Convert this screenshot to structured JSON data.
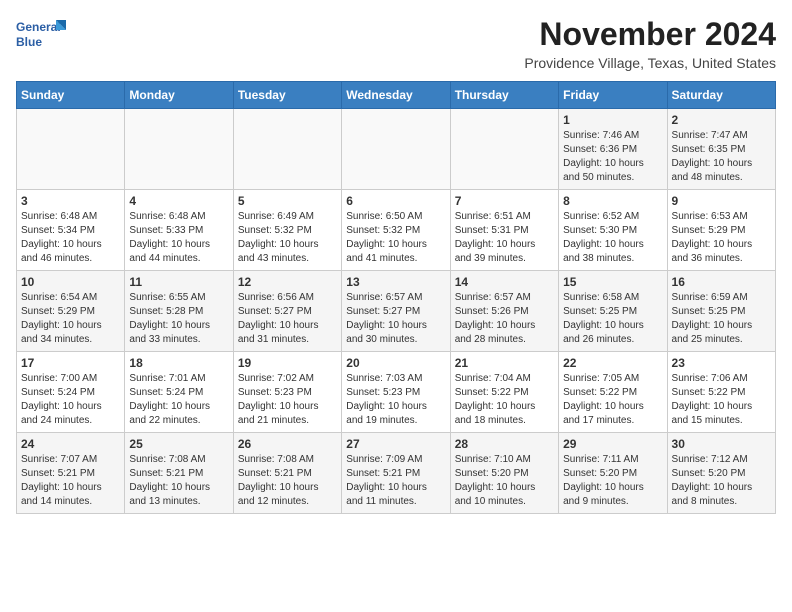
{
  "app": {
    "name": "GeneralBlue",
    "logo_line1": "General",
    "logo_line2": "Blue"
  },
  "header": {
    "month_year": "November 2024",
    "location": "Providence Village, Texas, United States"
  },
  "days_of_week": [
    "Sunday",
    "Monday",
    "Tuesday",
    "Wednesday",
    "Thursday",
    "Friday",
    "Saturday"
  ],
  "weeks": [
    [
      {
        "day": "",
        "info": ""
      },
      {
        "day": "",
        "info": ""
      },
      {
        "day": "",
        "info": ""
      },
      {
        "day": "",
        "info": ""
      },
      {
        "day": "",
        "info": ""
      },
      {
        "day": "1",
        "info": "Sunrise: 7:46 AM\nSunset: 6:36 PM\nDaylight: 10 hours and 50 minutes."
      },
      {
        "day": "2",
        "info": "Sunrise: 7:47 AM\nSunset: 6:35 PM\nDaylight: 10 hours and 48 minutes."
      }
    ],
    [
      {
        "day": "3",
        "info": "Sunrise: 6:48 AM\nSunset: 5:34 PM\nDaylight: 10 hours and 46 minutes."
      },
      {
        "day": "4",
        "info": "Sunrise: 6:48 AM\nSunset: 5:33 PM\nDaylight: 10 hours and 44 minutes."
      },
      {
        "day": "5",
        "info": "Sunrise: 6:49 AM\nSunset: 5:32 PM\nDaylight: 10 hours and 43 minutes."
      },
      {
        "day": "6",
        "info": "Sunrise: 6:50 AM\nSunset: 5:32 PM\nDaylight: 10 hours and 41 minutes."
      },
      {
        "day": "7",
        "info": "Sunrise: 6:51 AM\nSunset: 5:31 PM\nDaylight: 10 hours and 39 minutes."
      },
      {
        "day": "8",
        "info": "Sunrise: 6:52 AM\nSunset: 5:30 PM\nDaylight: 10 hours and 38 minutes."
      },
      {
        "day": "9",
        "info": "Sunrise: 6:53 AM\nSunset: 5:29 PM\nDaylight: 10 hours and 36 minutes."
      }
    ],
    [
      {
        "day": "10",
        "info": "Sunrise: 6:54 AM\nSunset: 5:29 PM\nDaylight: 10 hours and 34 minutes."
      },
      {
        "day": "11",
        "info": "Sunrise: 6:55 AM\nSunset: 5:28 PM\nDaylight: 10 hours and 33 minutes."
      },
      {
        "day": "12",
        "info": "Sunrise: 6:56 AM\nSunset: 5:27 PM\nDaylight: 10 hours and 31 minutes."
      },
      {
        "day": "13",
        "info": "Sunrise: 6:57 AM\nSunset: 5:27 PM\nDaylight: 10 hours and 30 minutes."
      },
      {
        "day": "14",
        "info": "Sunrise: 6:57 AM\nSunset: 5:26 PM\nDaylight: 10 hours and 28 minutes."
      },
      {
        "day": "15",
        "info": "Sunrise: 6:58 AM\nSunset: 5:25 PM\nDaylight: 10 hours and 26 minutes."
      },
      {
        "day": "16",
        "info": "Sunrise: 6:59 AM\nSunset: 5:25 PM\nDaylight: 10 hours and 25 minutes."
      }
    ],
    [
      {
        "day": "17",
        "info": "Sunrise: 7:00 AM\nSunset: 5:24 PM\nDaylight: 10 hours and 24 minutes."
      },
      {
        "day": "18",
        "info": "Sunrise: 7:01 AM\nSunset: 5:24 PM\nDaylight: 10 hours and 22 minutes."
      },
      {
        "day": "19",
        "info": "Sunrise: 7:02 AM\nSunset: 5:23 PM\nDaylight: 10 hours and 21 minutes."
      },
      {
        "day": "20",
        "info": "Sunrise: 7:03 AM\nSunset: 5:23 PM\nDaylight: 10 hours and 19 minutes."
      },
      {
        "day": "21",
        "info": "Sunrise: 7:04 AM\nSunset: 5:22 PM\nDaylight: 10 hours and 18 minutes."
      },
      {
        "day": "22",
        "info": "Sunrise: 7:05 AM\nSunset: 5:22 PM\nDaylight: 10 hours and 17 minutes."
      },
      {
        "day": "23",
        "info": "Sunrise: 7:06 AM\nSunset: 5:22 PM\nDaylight: 10 hours and 15 minutes."
      }
    ],
    [
      {
        "day": "24",
        "info": "Sunrise: 7:07 AM\nSunset: 5:21 PM\nDaylight: 10 hours and 14 minutes."
      },
      {
        "day": "25",
        "info": "Sunrise: 7:08 AM\nSunset: 5:21 PM\nDaylight: 10 hours and 13 minutes."
      },
      {
        "day": "26",
        "info": "Sunrise: 7:08 AM\nSunset: 5:21 PM\nDaylight: 10 hours and 12 minutes."
      },
      {
        "day": "27",
        "info": "Sunrise: 7:09 AM\nSunset: 5:21 PM\nDaylight: 10 hours and 11 minutes."
      },
      {
        "day": "28",
        "info": "Sunrise: 7:10 AM\nSunset: 5:20 PM\nDaylight: 10 hours and 10 minutes."
      },
      {
        "day": "29",
        "info": "Sunrise: 7:11 AM\nSunset: 5:20 PM\nDaylight: 10 hours and 9 minutes."
      },
      {
        "day": "30",
        "info": "Sunrise: 7:12 AM\nSunset: 5:20 PM\nDaylight: 10 hours and 8 minutes."
      }
    ]
  ]
}
